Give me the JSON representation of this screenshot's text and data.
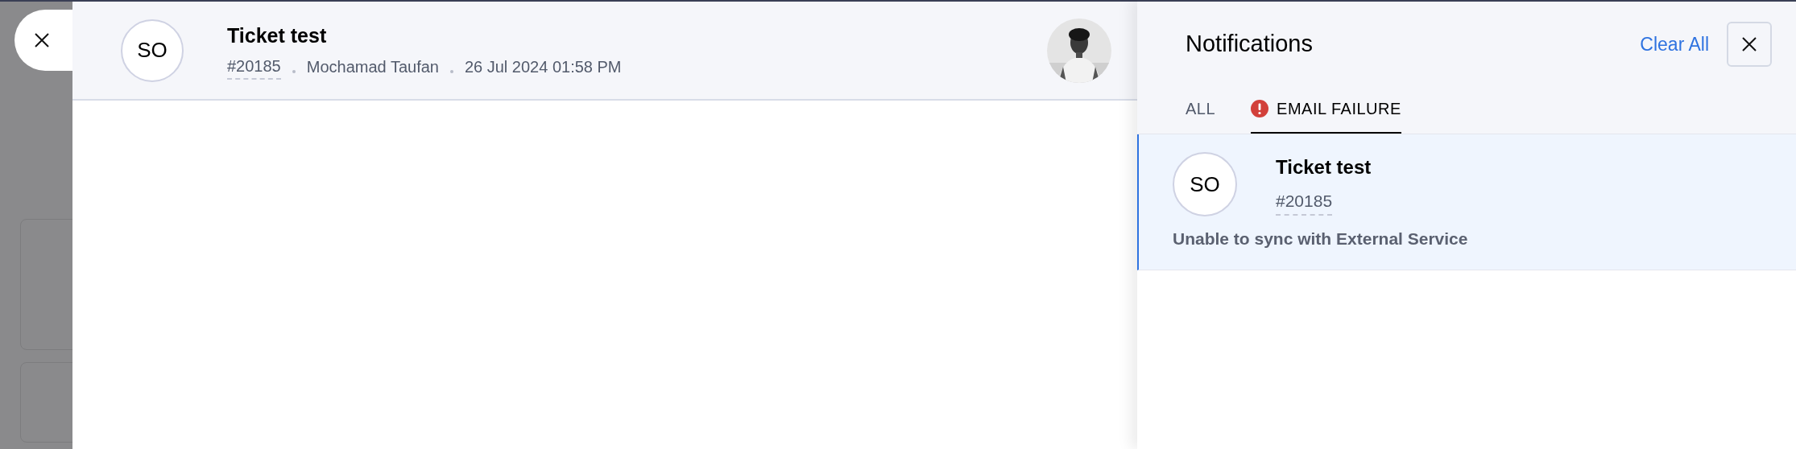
{
  "ticket": {
    "avatar_initials": "SO",
    "title": "Ticket test",
    "id": "#20185",
    "author": "Mochamad Taufan",
    "timestamp": "26 Jul 2024 01:58 PM"
  },
  "notifications": {
    "title": "Notifications",
    "clear_all": "Clear All",
    "tabs": [
      {
        "label": "ALL",
        "selected": false,
        "kind": "plain"
      },
      {
        "label": "EMAIL FAILURE",
        "selected": true,
        "kind": "alert"
      }
    ],
    "items": [
      {
        "avatar_initials": "SO",
        "title": "Ticket test",
        "id": "#20185",
        "message": "Unable to sync with External Service",
        "selected": true
      }
    ]
  }
}
